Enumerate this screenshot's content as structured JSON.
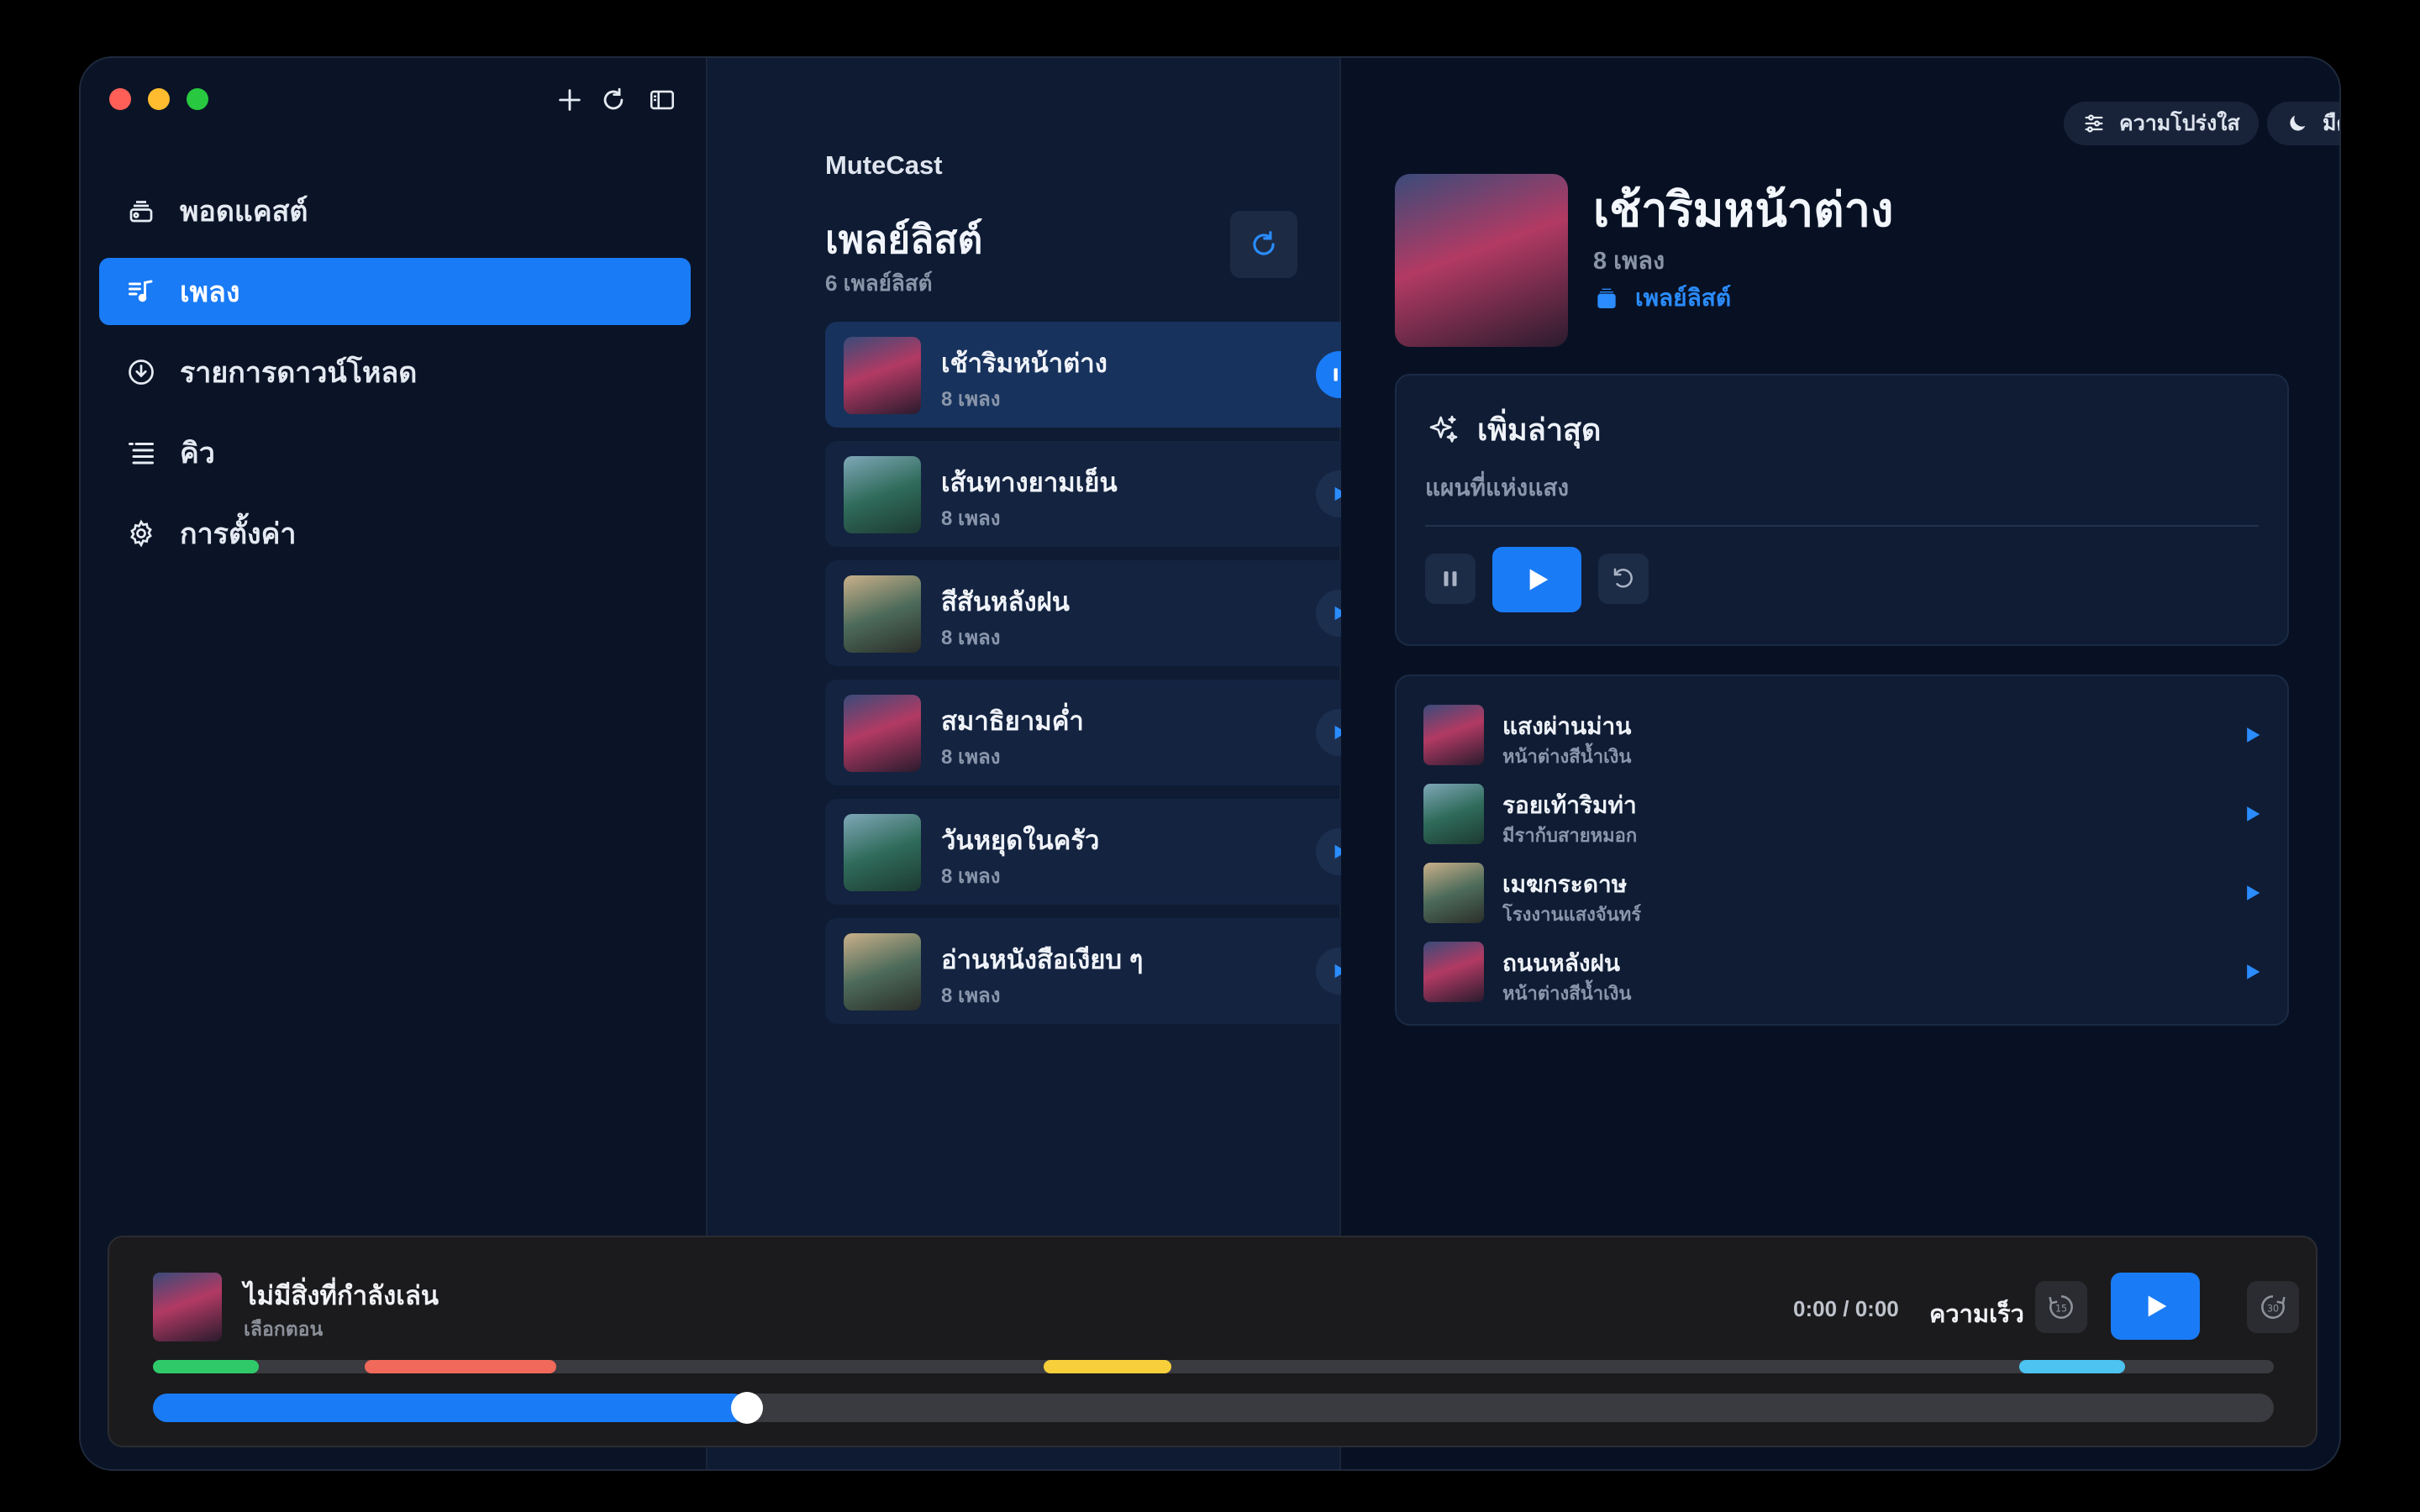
{
  "colors": {
    "accent": "#1a7bf6",
    "chapter_green": "#2fc96a",
    "chapter_red": "#f0695a",
    "chapter_yellow": "#f7cf3b",
    "chapter_cyan": "#4cc3f0"
  },
  "sidebar": {
    "items": [
      {
        "label": "พอดแคสต์",
        "icon": "podcast-icon",
        "active": false
      },
      {
        "label": "เพลง",
        "icon": "music-icon",
        "active": true
      },
      {
        "label": "รายการดาวน์โหลด",
        "icon": "download-icon",
        "active": false
      },
      {
        "label": "คิว",
        "icon": "queue-icon",
        "active": false
      },
      {
        "label": "การตั้งค่า",
        "icon": "gear-icon",
        "active": false
      }
    ]
  },
  "middle": {
    "app_name": "MuteCast",
    "title": "เพลย์ลิสต์",
    "count": "6 เพลย์ลิสต์",
    "playlists": [
      {
        "name": "เช้าริมหน้าต่าง",
        "sub": "8 เพลง",
        "playing": true
      },
      {
        "name": "เส้นทางยามเย็น",
        "sub": "8 เพลง",
        "playing": false
      },
      {
        "name": "สีสันหลังฝน",
        "sub": "8 เพลง",
        "playing": false
      },
      {
        "name": "สมาธิยามค่ำ",
        "sub": "8 เพลง",
        "playing": false
      },
      {
        "name": "วันหยุดในครัว",
        "sub": "8 เพลง",
        "playing": false
      },
      {
        "name": "อ่านหนังสือเงียบ ๆ",
        "sub": "8 เพลง",
        "playing": false
      }
    ]
  },
  "right": {
    "transparency_label": "ความโปร่งใส",
    "theme_label": "มืด",
    "title": "เช้าริมหน้าต่าง",
    "sub": "8 เพลง",
    "link": "เพลย์ลิสต์",
    "recent": {
      "title": "เพิ่มล่าสุด",
      "sub": "แผนที่แห่งแสง"
    },
    "tracks": [
      {
        "name": "แสงผ่านม่าน",
        "sub": "หน้าต่างสีน้ำเงิน"
      },
      {
        "name": "รอยเท้าริมท่า",
        "sub": "มีราก้บสายหมอก"
      },
      {
        "name": "เมฆกระดาษ",
        "sub": "โรงงานแสงจันทร์"
      },
      {
        "name": "ถนนหลังฝน",
        "sub": "หน้าต่างสีน้ำเงิน"
      }
    ]
  },
  "player": {
    "title": "ไม่มีสิ่งที่กำลังเล่น",
    "sub": "เลือกตอน",
    "time": "0:00 / 0:00",
    "speed_label": "ความเร็ว",
    "skip_back": "15",
    "skip_forward": "30",
    "progress": 0.28,
    "chapters": [
      {
        "start": 0.0,
        "end": 0.05,
        "color": "#2fc96a"
      },
      {
        "start": 0.1,
        "end": 0.19,
        "color": "#f0695a"
      },
      {
        "start": 0.42,
        "end": 0.48,
        "color": "#f7cf3b"
      },
      {
        "start": 0.88,
        "end": 0.93,
        "color": "#4cc3f0"
      }
    ]
  }
}
